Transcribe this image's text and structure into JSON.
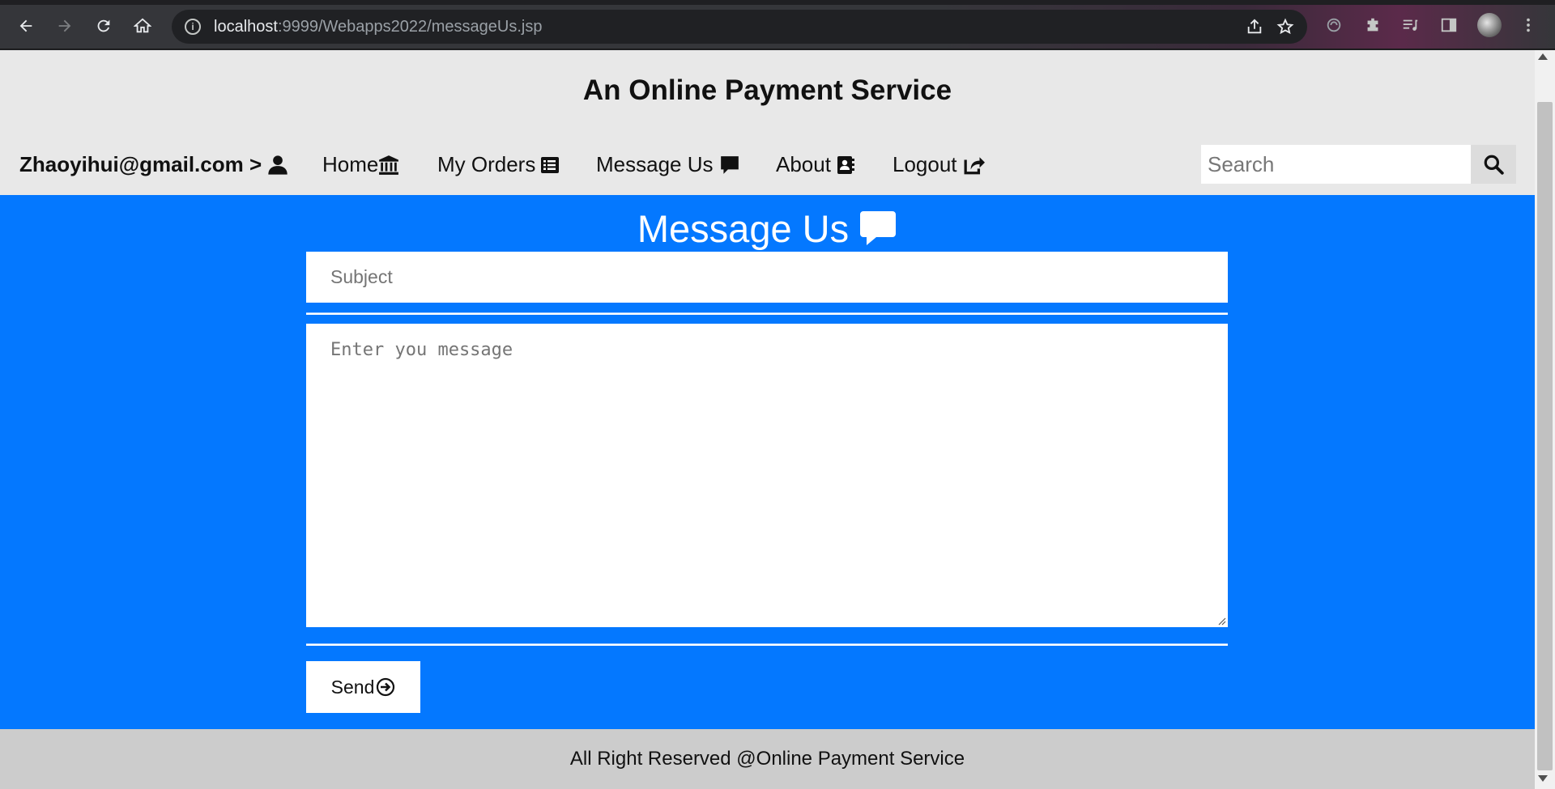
{
  "browser": {
    "url_host": "localhost",
    "url_rest": ":9999/Webapps2022/messageUs.jsp"
  },
  "header": {
    "title": "An Online Payment Service"
  },
  "nav": {
    "user": "Zhaoyihui@gmail.com >",
    "home": "Home",
    "orders": "My Orders",
    "message": "Message Us",
    "about": "About",
    "logout": "Logout",
    "search_placeholder": "Search"
  },
  "main": {
    "title": "Message Us",
    "subject_placeholder": "Subject",
    "message_placeholder": "Enter you message",
    "send_label": "Send"
  },
  "footer": {
    "text": "All Right Reserved @Online Payment Service"
  },
  "colors": {
    "header_bg": "#e8e8e8",
    "main_bg": "#0478ff",
    "footer_bg": "#cccccc"
  }
}
